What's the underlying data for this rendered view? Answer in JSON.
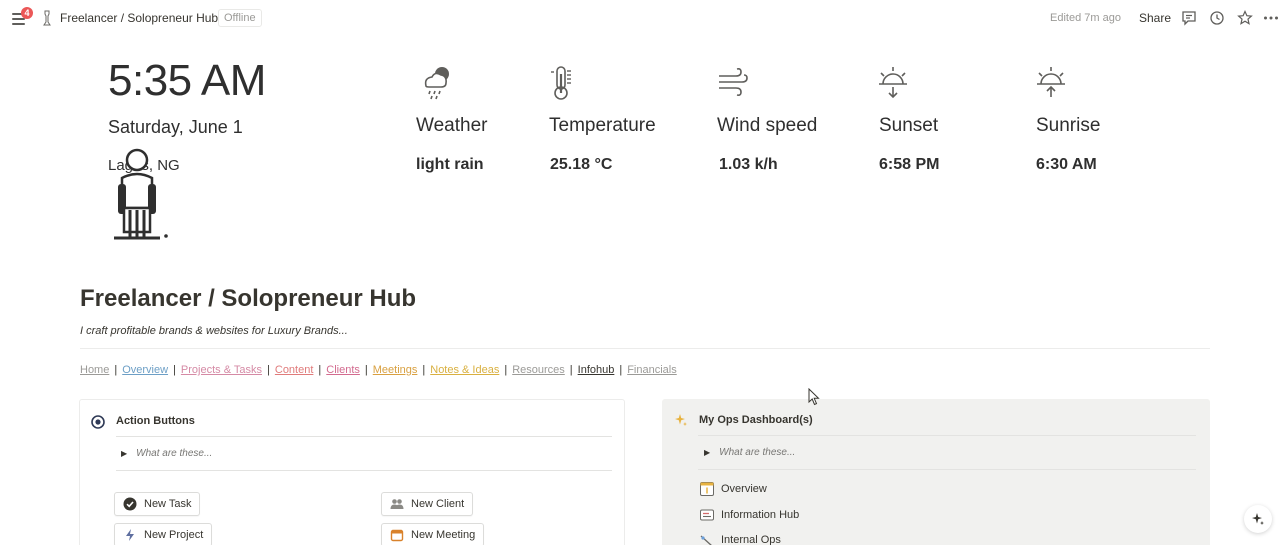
{
  "topbar": {
    "notifications": "4",
    "breadcrumb": "Freelancer / Solopreneur Hub",
    "status": "Offline",
    "edited": "Edited 7m ago",
    "share": "Share"
  },
  "clock": {
    "time": "5:35 AM",
    "date": "Saturday, June 1",
    "location": "Lagos, NG"
  },
  "weather": [
    {
      "label": "Weather",
      "value": "light rain",
      "icon": "cloud-rain-icon"
    },
    {
      "label": "Temperature",
      "value": "25.18 °C",
      "icon": "thermometer-icon"
    },
    {
      "label": "Wind speed",
      "value": "1.03 k/h",
      "icon": "wind-icon"
    },
    {
      "label": "Sunset",
      "value": "6:58 PM",
      "icon": "sunset-icon"
    },
    {
      "label": "Sunrise",
      "value": "6:30 AM",
      "icon": "sunrise-icon"
    }
  ],
  "page": {
    "title": "Freelancer / Solopreneur Hub",
    "subtitle": "I craft profitable brands & websites for Luxury Brands..."
  },
  "nav": [
    {
      "label": "Home",
      "color": "#9b9a97"
    },
    {
      "label": "Overview",
      "color": "#6d9fc6"
    },
    {
      "label": "Projects & Tasks",
      "color": "#d58aa5"
    },
    {
      "label": "Content",
      "color": "#e07b7b"
    },
    {
      "label": "Clients",
      "color": "#d36b8f"
    },
    {
      "label": "Meetings",
      "color": "#d9a040"
    },
    {
      "label": "Notes & Ideas",
      "color": "#d9b040"
    },
    {
      "label": "Resources",
      "color": "#9b9a97"
    },
    {
      "label": "Infohub",
      "color": "#37352f"
    },
    {
      "label": "Financials",
      "color": "#9b9a97"
    }
  ],
  "action_card": {
    "title": "Action Buttons",
    "toggle": "What are these...",
    "buttons": [
      "New Task",
      "New Client",
      "New Project",
      "New Meeting"
    ]
  },
  "ops_card": {
    "title": "My Ops Dashboard(s)",
    "toggle": "What are these...",
    "links": [
      "Overview",
      "Information Hub",
      "Internal Ops"
    ]
  },
  "colors": {
    "accent_red": "#eb5757",
    "card_bg": "#f1f1ef"
  }
}
